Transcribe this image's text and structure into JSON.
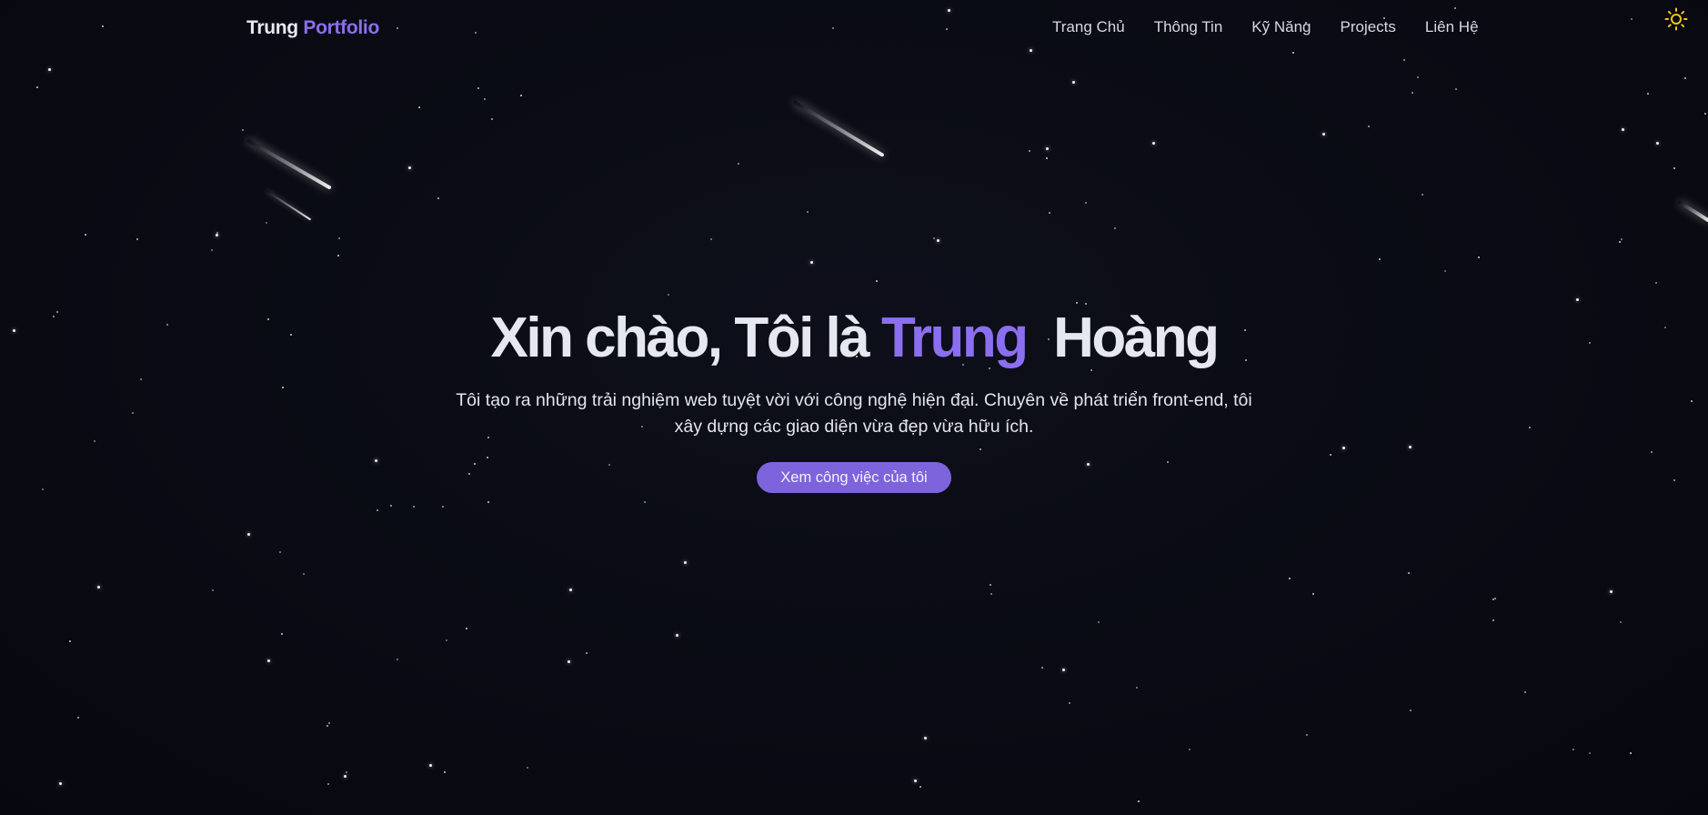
{
  "nav": {
    "logo_main": "Trung",
    "logo_accent": "Portfolio",
    "links": [
      "Trang Chủ",
      "Thông Tin",
      "Kỹ Năng",
      "Projects",
      "Liên Hệ"
    ],
    "theme_toggle_icon": "sun-icon"
  },
  "hero": {
    "title_prefix": "Xin chào, Tôi là",
    "title_accent": "Trung",
    "title_suffix": "Hoàng",
    "subtitle": "Tôi tạo ra những trải nghiệm web tuyệt vời với công nghệ hiện đại. Chuyên về phát triển front-end, tôi xây dựng các giao diện vừa đẹp vừa hữu ích.",
    "cta_label": "Xem công việc của tôi"
  },
  "theme": {
    "background": "#0a0b14",
    "accent": "#8b6ff0",
    "button": "#7d64dc",
    "sun": "#f5c518"
  },
  "decor": {
    "background_icon": "starfield",
    "meteor_icon": "shooting-star"
  }
}
